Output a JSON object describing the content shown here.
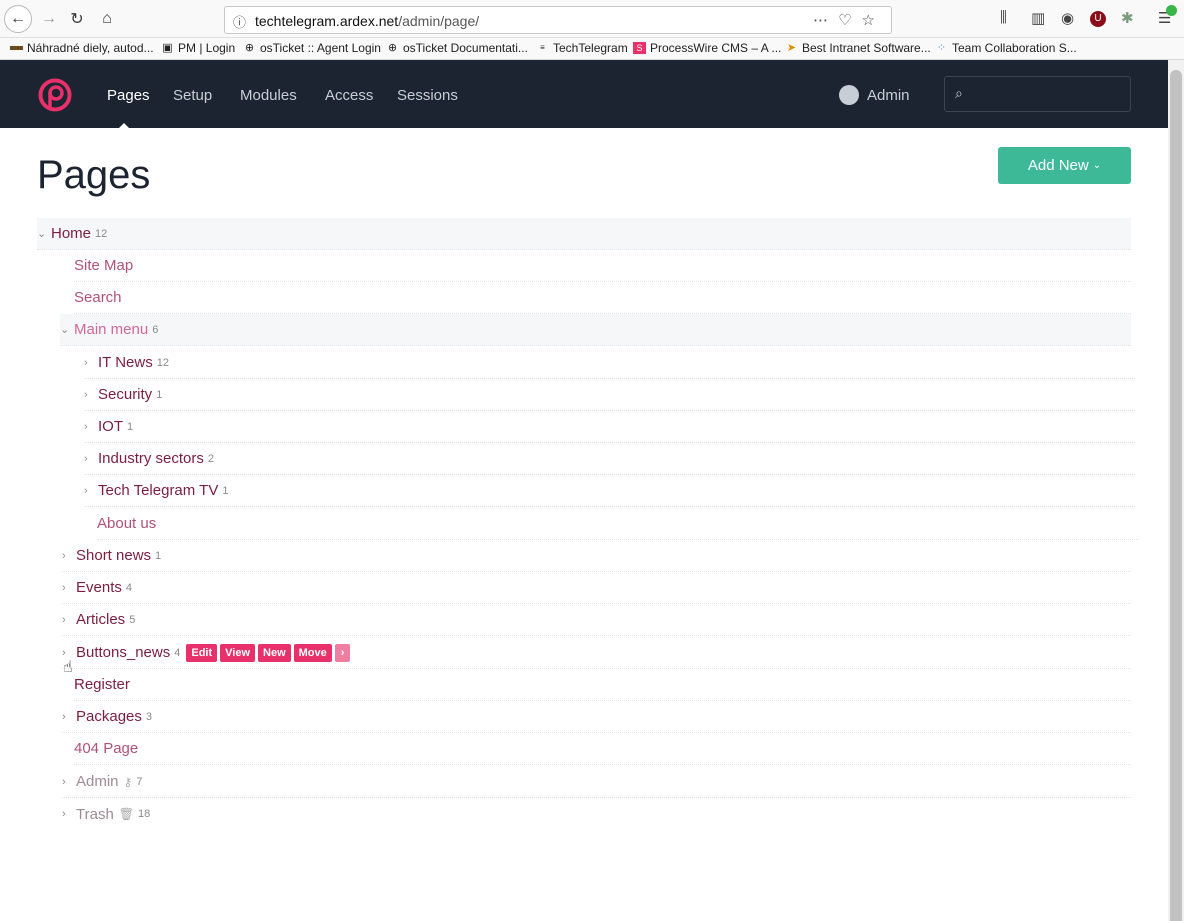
{
  "browser": {
    "url_host": "techtelegram.ardex.net",
    "url_path": "/admin/page/",
    "bookmarks": [
      {
        "label": "Náhradné diely, autod..."
      },
      {
        "label": "PM | Login"
      },
      {
        "label": "osTicket :: Agent Login"
      },
      {
        "label": "osTicket Documentati..."
      },
      {
        "label": "TechTelegram"
      },
      {
        "label": "ProcessWire CMS – A ..."
      },
      {
        "label": "Best Intranet Software..."
      },
      {
        "label": "Team Collaboration S..."
      }
    ]
  },
  "header": {
    "nav": [
      {
        "label": "Pages"
      },
      {
        "label": "Setup"
      },
      {
        "label": "Modules"
      },
      {
        "label": "Access"
      },
      {
        "label": "Sessions"
      }
    ],
    "user": "Admin",
    "brand_color": "#e8306a"
  },
  "main": {
    "title": "Pages",
    "add_new": "Add New"
  },
  "tree": [
    {
      "label": "Home",
      "count": "12"
    },
    {
      "label": "Site Map",
      "count": ""
    },
    {
      "label": "Search",
      "count": ""
    },
    {
      "label": "Main menu",
      "count": "6"
    },
    {
      "label": "IT News",
      "count": "12"
    },
    {
      "label": "Security",
      "count": "1"
    },
    {
      "label": "IOT",
      "count": "1"
    },
    {
      "label": "Industry sectors",
      "count": "2"
    },
    {
      "label": "Tech Telegram TV",
      "count": "1"
    },
    {
      "label": "About us",
      "count": ""
    },
    {
      "label": "Short news",
      "count": "1"
    },
    {
      "label": "Events",
      "count": "4"
    },
    {
      "label": "Articles",
      "count": "5"
    },
    {
      "label": "Buttons_news",
      "count": "4"
    },
    {
      "label": "Register",
      "count": ""
    },
    {
      "label": "Packages",
      "count": "3"
    },
    {
      "label": "404 Page",
      "count": ""
    },
    {
      "label": "Admin",
      "count": "7"
    },
    {
      "label": "Trash",
      "count": "18"
    }
  ],
  "row_actions": {
    "edit": "Edit",
    "view": "View",
    "new": "New",
    "move": "Move",
    "more": "›"
  }
}
